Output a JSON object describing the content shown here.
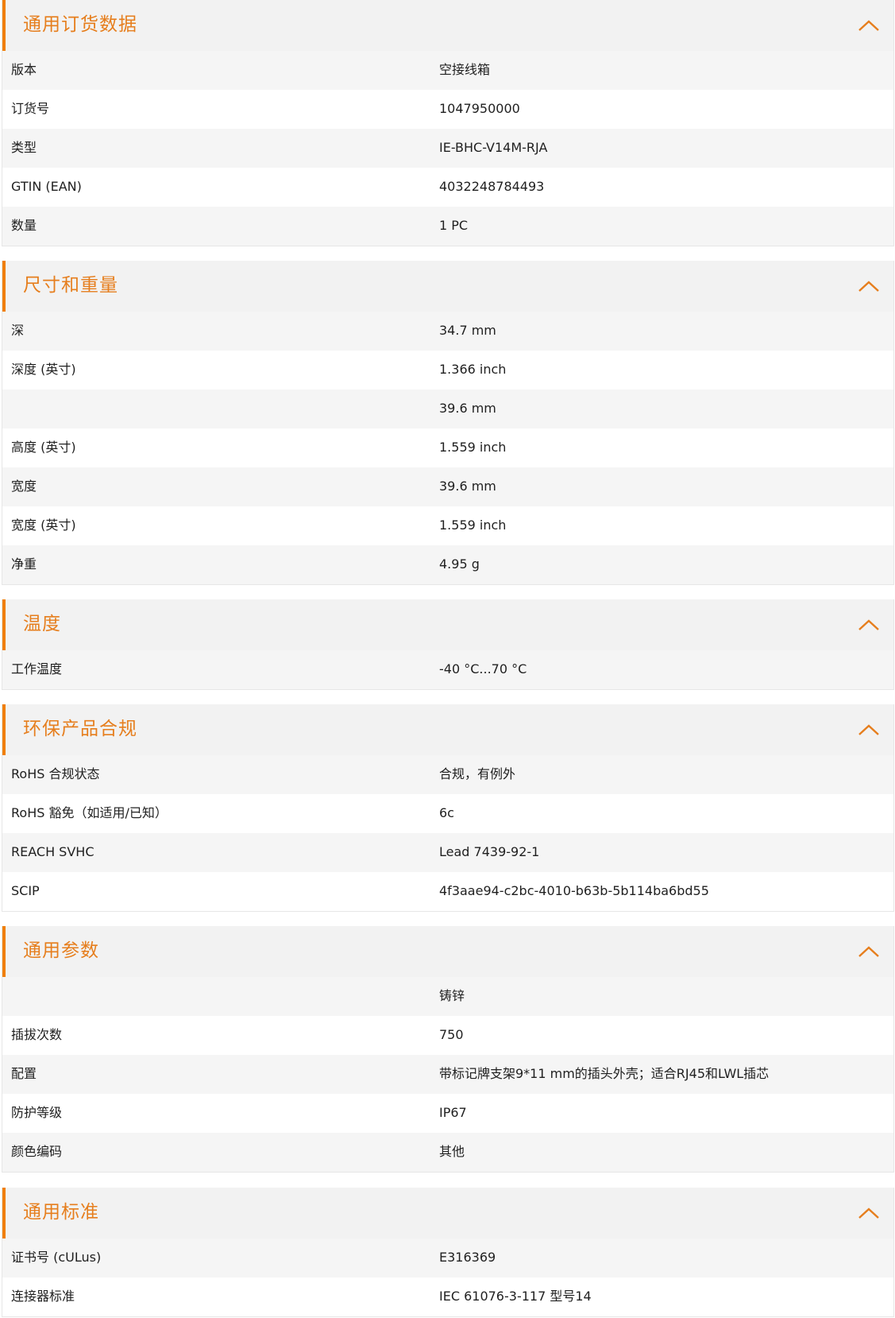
{
  "sections": [
    {
      "title": "通用订货数据",
      "rows": [
        {
          "label": "版本",
          "value": "空接线箱"
        },
        {
          "label": "订货号",
          "value": "1047950000"
        },
        {
          "label": "类型",
          "value": "IE-BHC-V14M-RJA"
        },
        {
          "label": "GTIN (EAN)",
          "value": "4032248784493"
        },
        {
          "label": "数量",
          "value": "1  PC"
        }
      ]
    },
    {
      "title": "尺寸和重量",
      "rows": [
        {
          "label": "深",
          "value": "34.7  mm"
        },
        {
          "label": "深度 (英寸)",
          "value": "1.366  inch"
        },
        {
          "label": "",
          "value": "39.6  mm"
        },
        {
          "label": "高度 (英寸)",
          "value": "1.559  inch"
        },
        {
          "label": "宽度",
          "value": "39.6  mm"
        },
        {
          "label": "宽度 (英寸)",
          "value": "1.559  inch"
        },
        {
          "label": "净重",
          "value": "4.95  g"
        }
      ]
    },
    {
      "title": "温度",
      "rows": [
        {
          "label": "工作温度",
          "value": "-40 °C...70 °C"
        }
      ]
    },
    {
      "title": "环保产品合规",
      "rows": [
        {
          "label": "RoHS 合规状态",
          "value": "合规，有例外"
        },
        {
          "label": "RoHS 豁免（如适用/已知）",
          "value": "6c"
        },
        {
          "label": "REACH SVHC",
          "value": "Lead 7439-92-1"
        },
        {
          "label": "SCIP",
          "value": "4f3aae94-c2bc-4010-b63b-5b114ba6bd55"
        }
      ]
    },
    {
      "title": "通用参数",
      "rows": [
        {
          "label": "",
          "value": "铸锌"
        },
        {
          "label": "插拔次数",
          "value": "750"
        },
        {
          "label": "配置",
          "value": "带标记牌支架9*11 mm的插头外壳；适合RJ45和LWL插芯"
        },
        {
          "label": "防护等级",
          "value": "IP67"
        },
        {
          "label": "颜色编码",
          "value": "其他"
        }
      ]
    },
    {
      "title": "通用标准",
      "rows": [
        {
          "label": "证书号 (cULus)",
          "value": "E316369"
        },
        {
          "label": "连接器标准",
          "value": "IEC 61076-3-117 型号14"
        }
      ]
    }
  ],
  "chevron_icon": "chevron-up-icon",
  "accent_color": "#e67e1d",
  "header_bar_color": "#f07f0b"
}
